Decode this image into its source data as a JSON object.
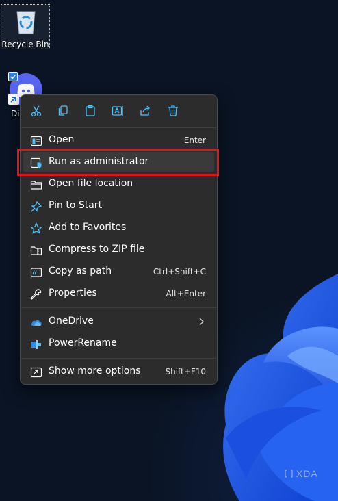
{
  "desktop": {
    "recycle_bin_label": "Recycle Bin",
    "discord_label": "Di"
  },
  "toolbar": {
    "buttons": [
      "cut-icon",
      "copy-icon",
      "paste-icon",
      "rename-icon",
      "share-icon",
      "delete-icon"
    ]
  },
  "menu": {
    "items": [
      {
        "label": "Open",
        "shortcut": "Enter",
        "icon": "open-window-icon"
      },
      {
        "label": "Run as administrator",
        "shortcut": "",
        "icon": "shield-icon"
      },
      {
        "label": "Open file location",
        "shortcut": "",
        "icon": "folder-icon"
      },
      {
        "label": "Pin to Start",
        "shortcut": "",
        "icon": "pin-icon"
      },
      {
        "label": "Add to Favorites",
        "shortcut": "",
        "icon": "star-icon"
      },
      {
        "label": "Compress to ZIP file",
        "shortcut": "",
        "icon": "zip-folder-icon"
      },
      {
        "label": "Copy as path",
        "shortcut": "Ctrl+Shift+C",
        "icon": "copy-path-icon"
      },
      {
        "label": "Properties",
        "shortcut": "Alt+Enter",
        "icon": "wrench-icon"
      },
      {
        "label": "OneDrive",
        "shortcut": "",
        "icon": "onedrive-cloud-icon"
      },
      {
        "label": "PowerRename",
        "shortcut": "",
        "icon": "powerrename-icon"
      },
      {
        "label": "Show more options",
        "shortcut": "Shift+F10",
        "icon": "show-more-icon"
      }
    ]
  },
  "colors": {
    "menu_bg": "#2c2c2c",
    "accent": "#4cc2ff",
    "highlight_border": "#e0141c",
    "discord": "#5865f2"
  },
  "watermark": "XDA"
}
